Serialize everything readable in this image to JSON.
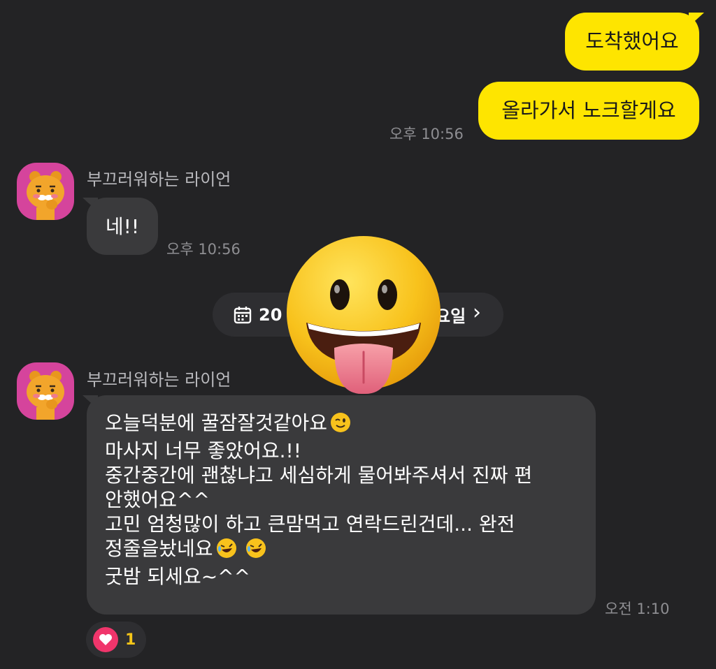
{
  "outgoing": {
    "messages": [
      {
        "text": "도착했어요"
      },
      {
        "text": "올라가서 노크할게요"
      }
    ],
    "time": "오후 10:56"
  },
  "incoming_1": {
    "sender": "부끄러워하는 라이언",
    "text": "네!!",
    "time": "오후 10:56"
  },
  "date_divider": {
    "visible_start": "20",
    "visible_end": "요일",
    "icon": "calendar-icon",
    "chevron": "›"
  },
  "incoming_2": {
    "sender": "부끄러워하는 라이언",
    "lines": [
      "오늘덕분에 꿀잠잘것같아요",
      "마사지 너무 좋았어요.!!",
      "중간중간에 괜찮냐고 세심하게 물어봐주셔서 진짜 편",
      "안했어요^^",
      "고민 엄청많이 하고 큰맘먹고 연락드린건데... 완전",
      "정줄을놨네요",
      "굿밤 되세요~^^"
    ],
    "time": "오전 1:10"
  },
  "reaction": {
    "icon": "heart-icon",
    "count": "1"
  },
  "colors": {
    "background": "#232325",
    "outgoing_bubble": "#fee500",
    "incoming_bubble": "#3a3a3c",
    "reaction_heart": "#f0356b",
    "avatar_bg": "#d5449c"
  }
}
